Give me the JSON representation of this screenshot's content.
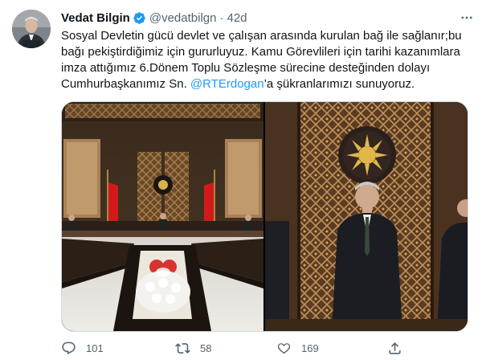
{
  "tweet": {
    "author_name": "Vedat Bilgin",
    "author_handle": "@vedatbilgn",
    "separator": "·",
    "time": "42d",
    "text_lines": [
      "Sosyal Devletin gücü devlet ve çalışan arasında kurulan bağ ile sağlanır;bu",
      "bağı pekiştirdiğimiz için gururluyuz. Kamu Görevlileri için tarihi kazanımlara",
      "imza attığımız 6.Dönem Toplu Sözleşme sürecine desteğinden dolayı"
    ],
    "last_line_prefix": "Cumhurbaşkanımız Sn. ",
    "mention": "@RTErdogan",
    "last_line_suffix": "’a şükranlarımızı sunuyoruz."
  },
  "actions": {
    "reply_count": "101",
    "retweet_count": "58",
    "like_count": "169"
  },
  "colors": {
    "accent": "#1d9bf0",
    "text": "#0f1419",
    "secondary": "#536471",
    "border": "#cfd9de"
  },
  "icons": [
    "verified-badge-icon",
    "more-icon",
    "reply-icon",
    "retweet-icon",
    "like-icon",
    "share-icon"
  ]
}
